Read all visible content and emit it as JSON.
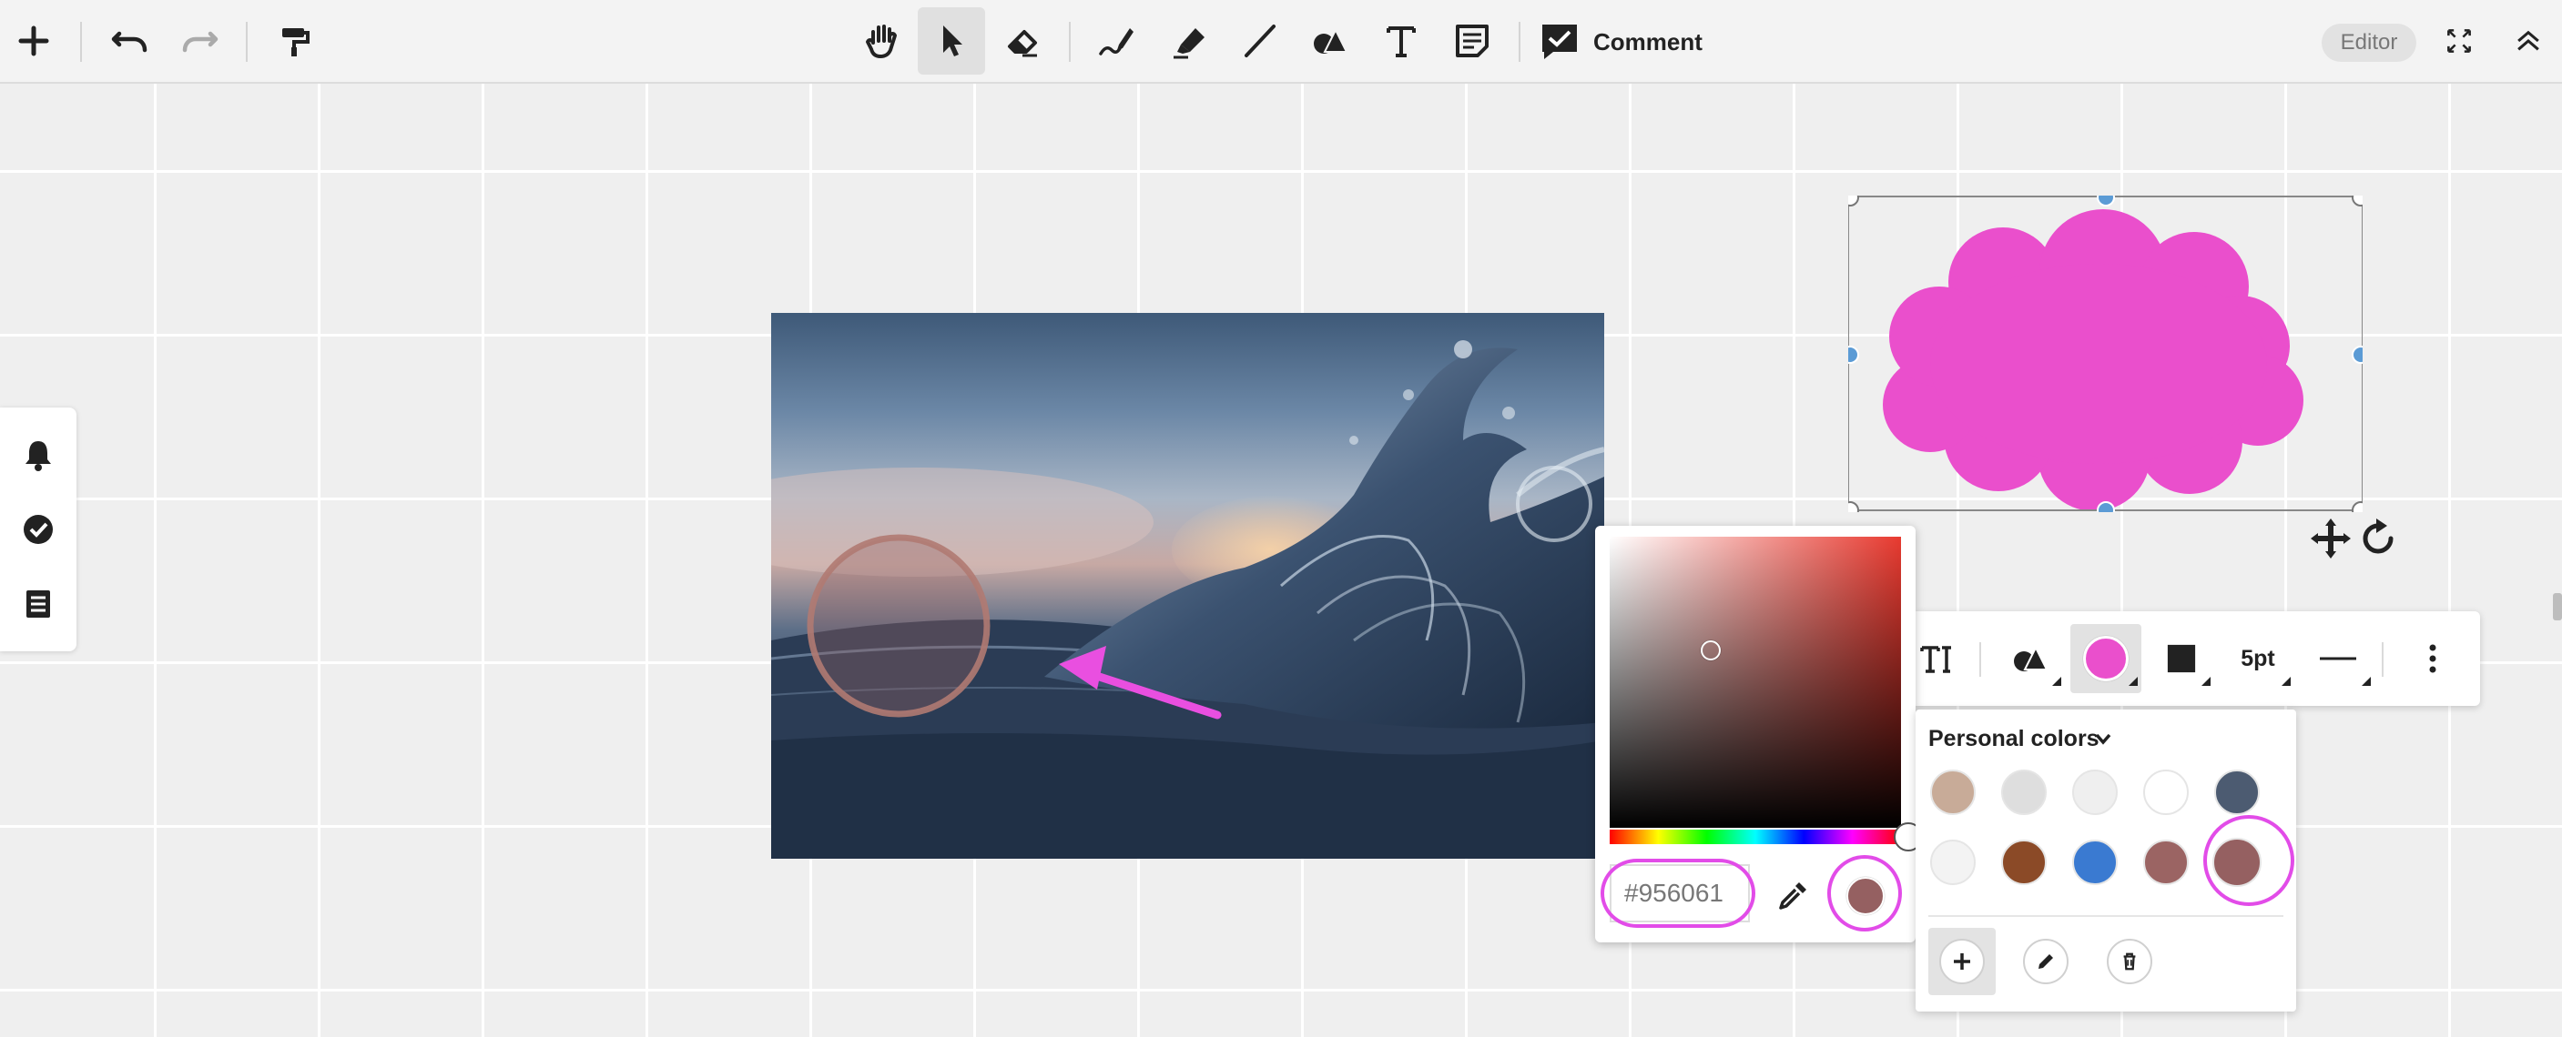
{
  "toolbar": {
    "tools": [
      {
        "name": "add",
        "icon": "plus-icon"
      },
      {
        "name": "undo",
        "icon": "undo-icon"
      },
      {
        "name": "redo",
        "icon": "redo-icon"
      },
      {
        "name": "format-painter",
        "icon": "paint-roller-icon"
      },
      {
        "name": "pan",
        "icon": "hand-icon"
      },
      {
        "name": "select",
        "icon": "pointer-icon",
        "active": true
      },
      {
        "name": "eraser",
        "icon": "eraser-icon"
      },
      {
        "name": "pen",
        "icon": "pen-icon"
      },
      {
        "name": "highlighter",
        "icon": "highlighter-icon"
      },
      {
        "name": "line",
        "icon": "line-icon"
      },
      {
        "name": "shapes",
        "icon": "shapes-icon"
      },
      {
        "name": "text",
        "icon": "text-icon"
      },
      {
        "name": "sticky-note",
        "icon": "sticky-note-icon"
      }
    ],
    "comment_label": "Comment",
    "editor_badge": "Editor"
  },
  "side_panel": {
    "icons": [
      "bell-icon",
      "check-circle-icon",
      "list-icon"
    ]
  },
  "color_picker": {
    "hex_value": "#956061",
    "selected_color": "#956061"
  },
  "shape_toolbar": {
    "fill_color": "#ea4fcc",
    "stroke_width_label": "5pt"
  },
  "personal_colors": {
    "title": "Personal colors",
    "swatches": [
      "#c8ab98",
      "#dedede",
      "#efefef",
      "#ffffff",
      "#4c5b71",
      "#f3f3f3",
      "#8b4a27",
      "#3a7ad1",
      "#9b6463",
      "#956061"
    ],
    "selected_index": 9
  },
  "canvas": {
    "cloud_fill": "#ea4fcc",
    "annotation_color": "#e94fe0"
  }
}
